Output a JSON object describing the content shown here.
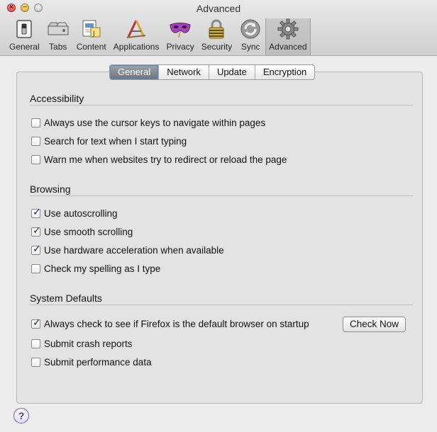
{
  "window": {
    "title": "Advanced"
  },
  "toolbar": {
    "items": [
      {
        "label": "General",
        "icon": "switch-icon"
      },
      {
        "label": "Tabs",
        "icon": "tabs-icon"
      },
      {
        "label": "Content",
        "icon": "content-icon"
      },
      {
        "label": "Applications",
        "icon": "applications-icon"
      },
      {
        "label": "Privacy",
        "icon": "privacy-mask-icon"
      },
      {
        "label": "Security",
        "icon": "padlock-icon"
      },
      {
        "label": "Sync",
        "icon": "sync-icon"
      },
      {
        "label": "Advanced",
        "icon": "gear-icon"
      }
    ],
    "active": "Advanced"
  },
  "tabs": {
    "items": [
      "General",
      "Network",
      "Update",
      "Encryption"
    ],
    "active": "General"
  },
  "sections": {
    "accessibility": {
      "title": "Accessibility",
      "options": [
        {
          "label": "Always use the cursor keys to navigate within pages",
          "checked": false
        },
        {
          "label": "Search for text when I start typing",
          "checked": false
        },
        {
          "label": "Warn me when websites try to redirect or reload the page",
          "checked": false
        }
      ]
    },
    "browsing": {
      "title": "Browsing",
      "options": [
        {
          "label": "Use autoscrolling",
          "checked": true
        },
        {
          "label": "Use smooth scrolling",
          "checked": true
        },
        {
          "label": "Use hardware acceleration when available",
          "checked": true
        },
        {
          "label": "Check my spelling as I type",
          "checked": false
        }
      ]
    },
    "system_defaults": {
      "title": "System Defaults",
      "options": [
        {
          "label": "Always check to see if Firefox is the default browser on startup",
          "checked": true
        },
        {
          "label": "Submit crash reports",
          "checked": false
        },
        {
          "label": "Submit performance data",
          "checked": false
        }
      ],
      "check_now_label": "Check Now"
    }
  },
  "help": {
    "label": "?"
  },
  "colors": {
    "accent": "#4f87c9",
    "active_tab": "#7a7f86",
    "help": "#7a6aa8"
  }
}
